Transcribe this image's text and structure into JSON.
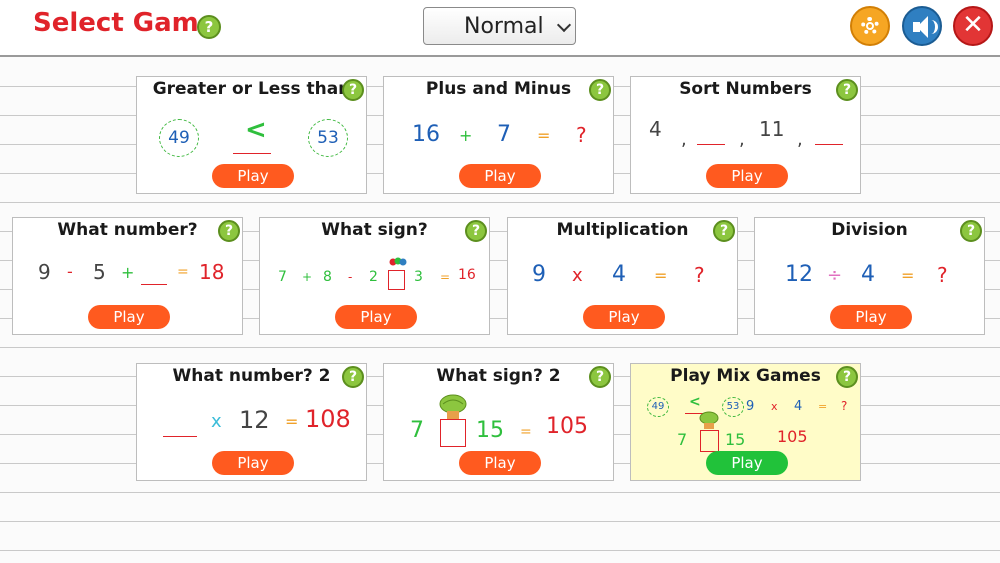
{
  "header": {
    "title": "Select Game",
    "help_icon": "help-icon",
    "difficulty": "Normal",
    "buttons": [
      {
        "name": "settings",
        "icon": "gear-icon"
      },
      {
        "name": "sound",
        "icon": "speaker-icon"
      },
      {
        "name": "close",
        "icon": "close-icon",
        "glyph": "✕"
      }
    ]
  },
  "colors": {
    "accent_red": "#e0232a",
    "play_orange": "#ff5a1f",
    "play_green": "#21c23a",
    "help_green": "#8cc63f",
    "highlight": "#fffcc8"
  },
  "cards": {
    "greater_less": {
      "title": "Greater or Less than",
      "play": "Play",
      "left": "49",
      "sign": "<",
      "right": "53"
    },
    "plus_minus": {
      "title": "Plus and Minus",
      "play": "Play",
      "a": "16",
      "op": "+",
      "b": "7",
      "eq": "=",
      "result": "?"
    },
    "sort_numbers": {
      "title": "Sort Numbers",
      "play": "Play",
      "first": "4",
      "sep1": ",",
      "sep2": ",",
      "third": "11",
      "sep3": ","
    },
    "what_number": {
      "title": "What number?",
      "play": "Play",
      "a": "9",
      "op1": "-",
      "b": "5",
      "op2": "+",
      "eq": "=",
      "result": "18"
    },
    "what_sign": {
      "title": "What sign?",
      "play": "Play",
      "a": "7",
      "op1": "+",
      "b": "8",
      "op2": "-",
      "c": "2",
      "d": "3",
      "eq": "=",
      "result": "16"
    },
    "multiplication": {
      "title": "Multiplication",
      "play": "Play",
      "a": "9",
      "op": "x",
      "b": "4",
      "eq": "=",
      "result": "?"
    },
    "division": {
      "title": "Division",
      "play": "Play",
      "a": "12",
      "op": "÷",
      "b": "4",
      "eq": "=",
      "result": "?"
    },
    "what_number_2": {
      "title": "What number? 2",
      "play": "Play",
      "op": "x",
      "b": "12",
      "eq": "=",
      "result": "108"
    },
    "what_sign_2": {
      "title": "What sign? 2",
      "play": "Play",
      "a": "7",
      "b": "15",
      "eq": "=",
      "result": "105"
    },
    "mix_games": {
      "title": "Play Mix Games",
      "play": "Play",
      "left": "49",
      "sign": "<",
      "right": "53",
      "m_a": "9",
      "m_op": "x",
      "m_b": "4",
      "m_eq": "=",
      "m_res": "?",
      "s_a": "7",
      "s_b": "15",
      "s_res": "105"
    }
  }
}
